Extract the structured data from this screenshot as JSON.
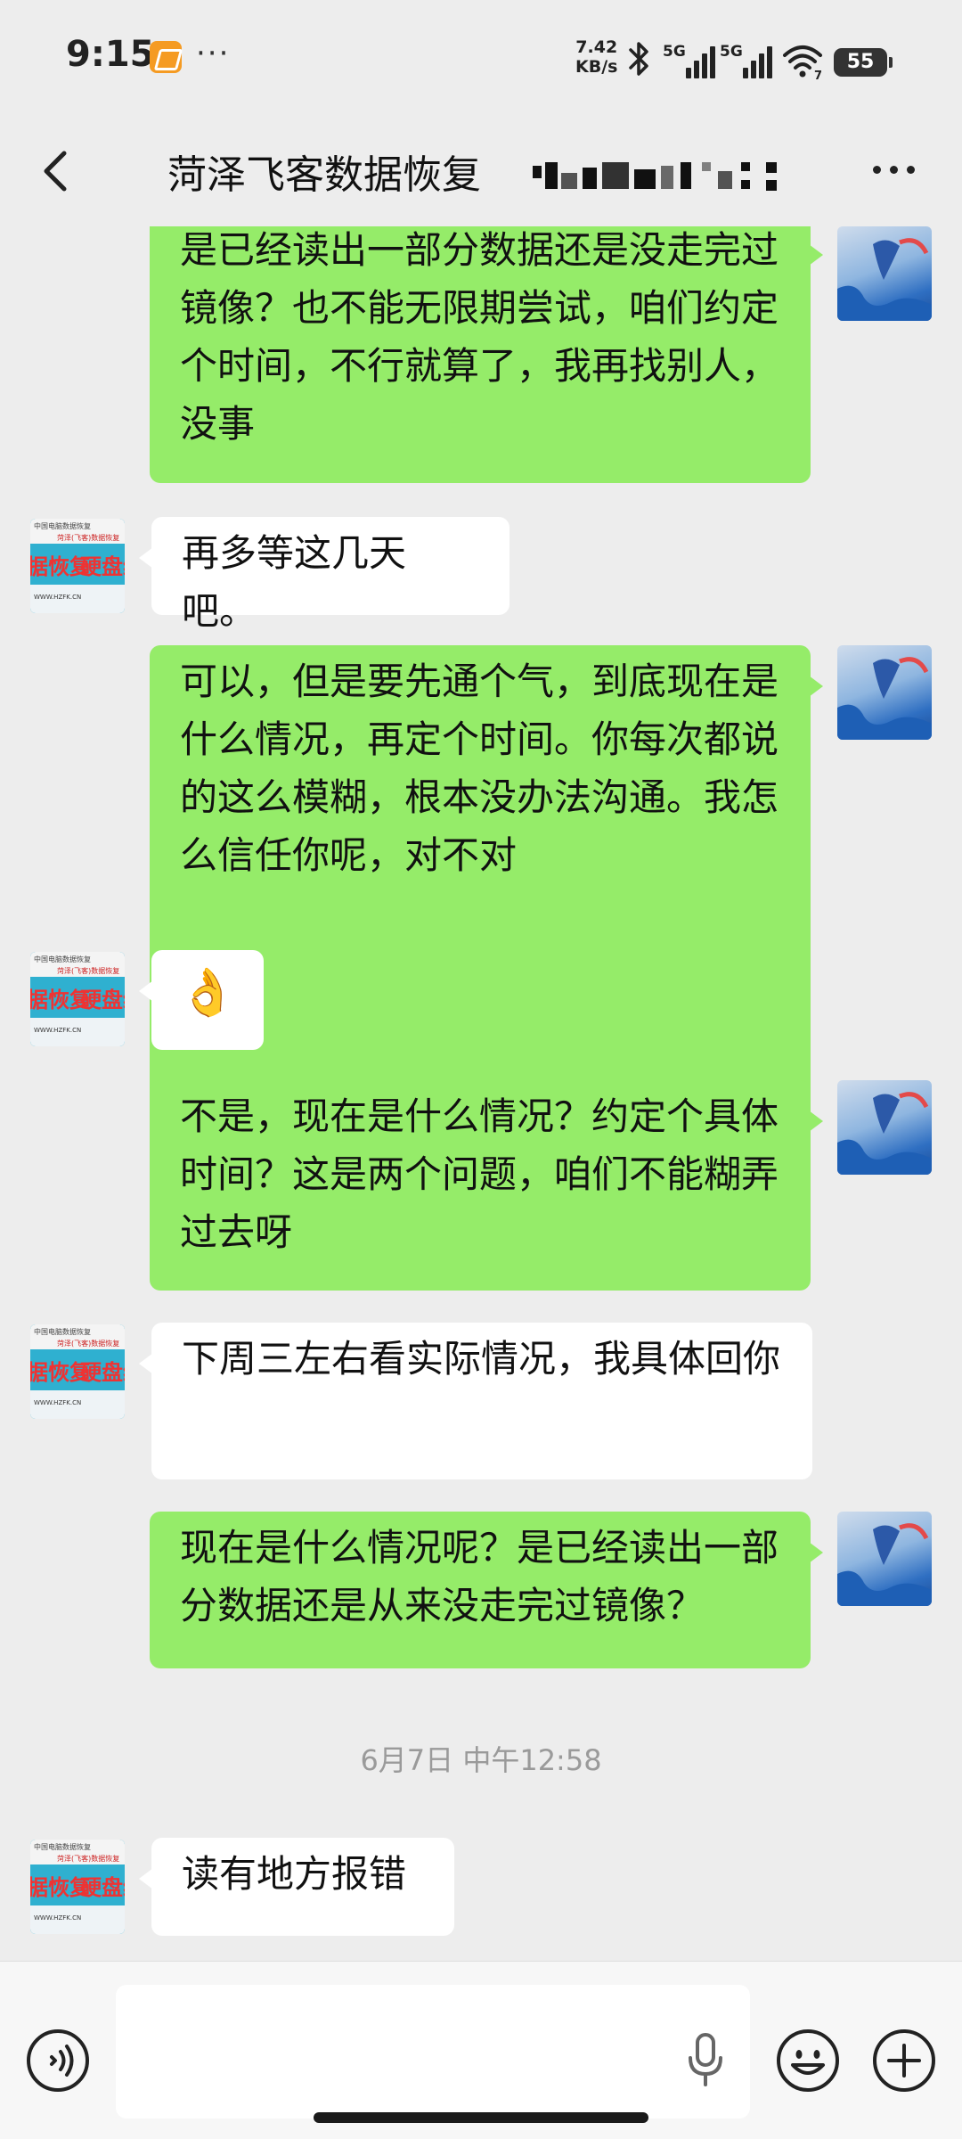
{
  "status_bar": {
    "time": "9:15",
    "more": "···",
    "net_speed_value": "7.42",
    "net_speed_unit": "KB/s",
    "sim1": "5G",
    "sim2": "5G",
    "wifi_tag": "7",
    "battery": "55"
  },
  "header": {
    "title": "菏泽飞客数据恢复"
  },
  "messages": [
    {
      "from": "me",
      "text": "是已经读出一部分数据还是没走完过镜像？也不能无限期尝试，咱们约定个时间，不行就算了，我再找别人，没事"
    },
    {
      "from": "them",
      "text": "再多等这几天吧。"
    },
    {
      "from": "me",
      "text": "可以，但是要先通个气，到底现在是什么情况，再定个时间。你每次都说的这么模糊，根本没办法沟通。我怎么信任你呢，对不对"
    },
    {
      "from": "them",
      "text": "👌"
    },
    {
      "from": "me",
      "text": "不是，现在是什么情况？约定个具体时间？这是两个问题，咱们不能糊弄过去呀"
    },
    {
      "from": "them",
      "text": "下周三左右看实际情况，我具体回你"
    },
    {
      "from": "me",
      "text": "现在是什么情况呢？是已经读出一部分数据还是从来没走完过镜像？"
    },
    {
      "from": "system",
      "text": "6月7日 中午12:58"
    },
    {
      "from": "them",
      "text": "读有地方报错"
    }
  ],
  "avatar_them": {
    "line_a": "中国电脑数据恢复",
    "line_b": "菏泽(飞客)数据恢复",
    "big_a": "据恢复",
    "big_b": "硬盘维",
    "url": "WWW.HZFK.CN"
  },
  "colors": {
    "sent_bubble": "#95ec69",
    "recv_bubble": "#ffffff",
    "background": "#ededed"
  },
  "icons": {
    "back": "chevron-left-icon",
    "more": "more-dots-icon",
    "voice": "voice-mode-icon",
    "mic": "microphone-icon",
    "emoji": "emoji-icon",
    "plus": "plus-icon"
  }
}
